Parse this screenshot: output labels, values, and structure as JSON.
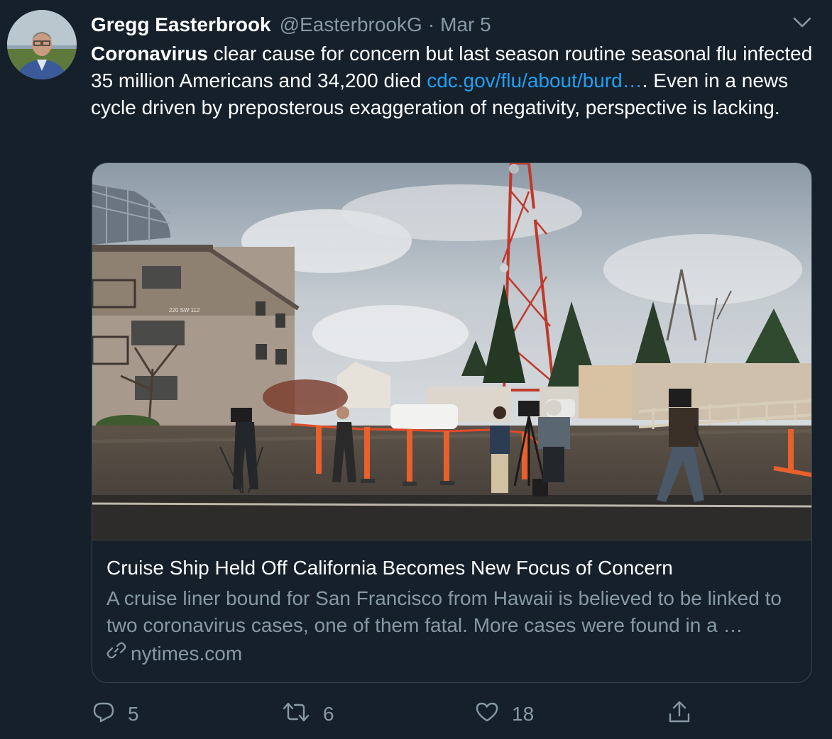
{
  "author": {
    "display_name": "Gregg Easterbrook",
    "handle": "@EasterbrookG",
    "separator": "·",
    "date": "Mar 5"
  },
  "tweet": {
    "bold_lead": "Coronavirus",
    "text_part1": " clear cause for concern but last season routine seasonal flu infected 35 million Americans and 34,200 died ",
    "link_text": "cdc.gov/flu/about/burd…",
    "text_part2": ". Even in a news cycle driven by preposterous exaggeration of negativity, perspective is lacking."
  },
  "card": {
    "title": "Cruise Ship Held Off California Becomes New Focus of Concern",
    "description": "A cruise liner bound for San Francisco from Hawaii is believed to be linked to two coronavirus cases, one of them fatal. More cases were found in a …",
    "domain": "nytimes.com",
    "image_sign_text": "220 SW 112"
  },
  "actions": {
    "reply_count": "5",
    "retweet_count": "6",
    "like_count": "18"
  },
  "colors": {
    "background": "#15202b",
    "secondary_text": "#8899a6",
    "link": "#1da1f2",
    "border": "#38444d"
  },
  "icons": [
    "chevron-down-icon",
    "link-icon",
    "reply-icon",
    "retweet-icon",
    "like-icon",
    "share-icon"
  ]
}
